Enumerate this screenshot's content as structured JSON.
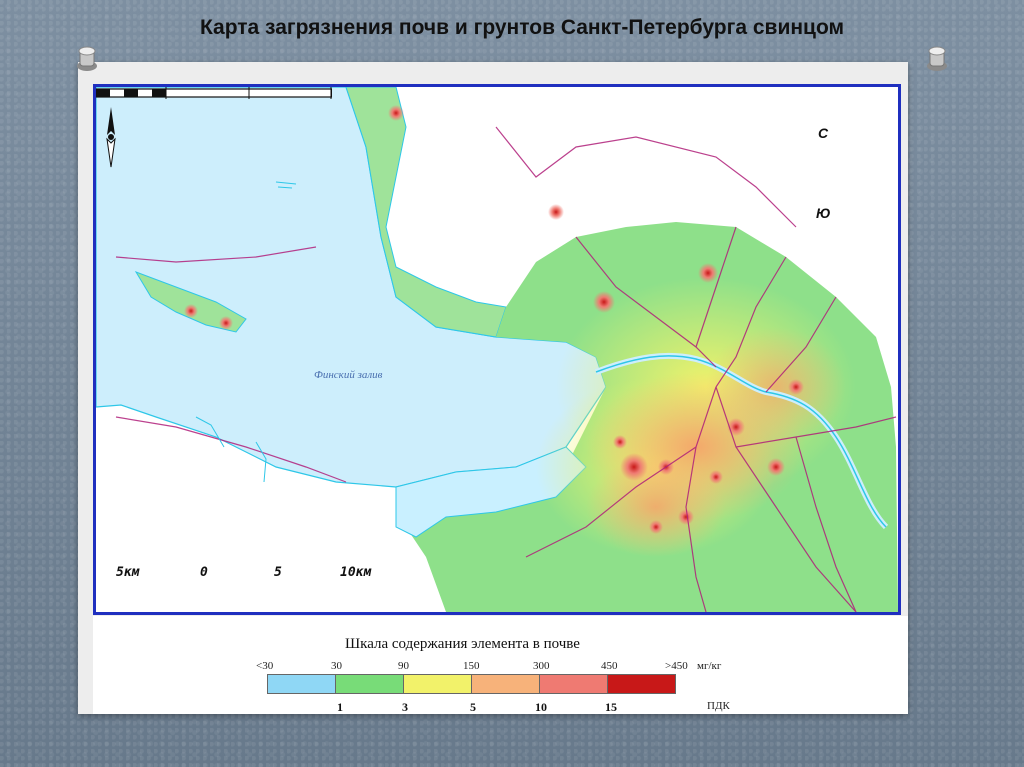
{
  "title": "Карта загрязнения почв и грунтов Санкт-Петербурга свинцом",
  "map": {
    "gulf_label": "Финский залив",
    "compass_north": "С",
    "compass_south": "Ю",
    "scale_labels": [
      "5км",
      "0",
      "5",
      "10км"
    ]
  },
  "legend": {
    "title": "Шкала содержания элемента в почве",
    "unit": "мг/кг",
    "pdk_label": "ПДК",
    "classes": [
      {
        "range_label": "<30",
        "color": "#8fd7f5"
      },
      {
        "range_label": "30",
        "color": "#78dc78"
      },
      {
        "range_label": "90",
        "color": "#f2f26a"
      },
      {
        "range_label": "150",
        "color": "#f7b27a"
      },
      {
        "range_label": "300",
        "color": "#ef7a72"
      },
      {
        "range_label": "450",
        "color": "#c81818"
      }
    ],
    "top_label": ">450",
    "pdk_values": [
      "1",
      "3",
      "5",
      "10",
      "15"
    ]
  },
  "colors": {
    "frame": "#1f2fbf",
    "district_lines": "#b0207a",
    "water_lines": "#2ec7e8",
    "water": "#cdeefc"
  }
}
